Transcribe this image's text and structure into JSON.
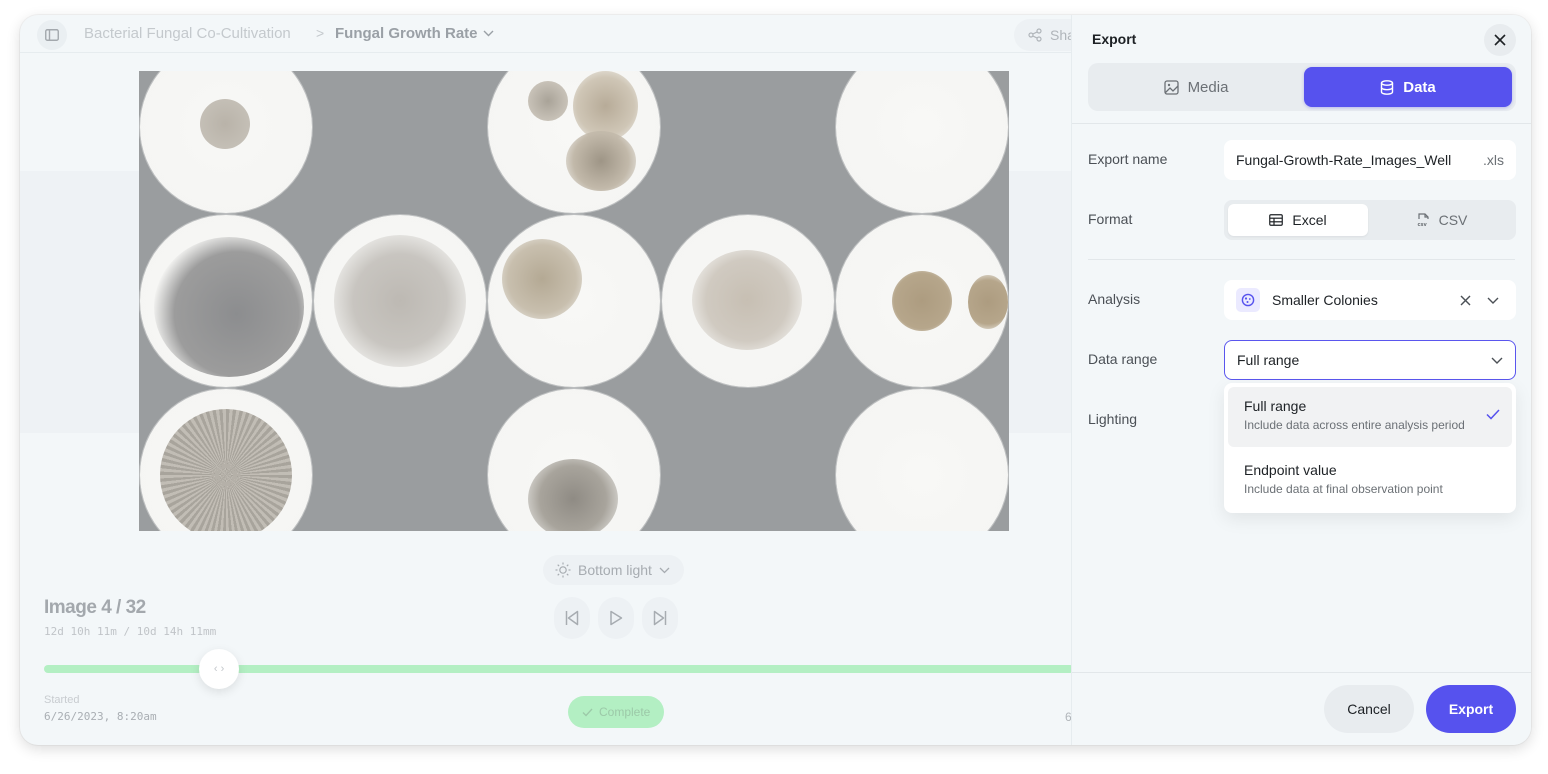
{
  "header": {
    "breadcrumb_root": "Bacterial Fungal Co-Cultivation",
    "breadcrumb_separator": ">",
    "breadcrumb_current": "Fungal Growth Rate",
    "share_label": "Sha"
  },
  "viewer": {
    "lighting_label": "Bottom light",
    "image_counter": "Image 4 / 32",
    "image_time": "12d 10h 11m / 10d 14h 11mm",
    "timeline_position_fraction": 0.17,
    "started_label": "Started",
    "started_value": "6/26/2023, 8:20am",
    "status_label": "Complete",
    "end_value_partial": "6",
    "status_color": "#b3efc3"
  },
  "export_panel": {
    "title": "Export",
    "tabs": [
      {
        "label": "Media",
        "icon": "image-icon",
        "active": false
      },
      {
        "label": "Data",
        "icon": "database-icon",
        "active": true
      }
    ],
    "export_name_label": "Export name",
    "export_name_value": "Fungal-Growth-Rate_Images_Well",
    "export_name_extension": ".xls",
    "format_label": "Format",
    "format_options": [
      {
        "label": "Excel",
        "icon": "table-icon",
        "selected": true
      },
      {
        "label": "CSV",
        "icon": "csv-file-icon",
        "selected": false
      }
    ],
    "analysis_label": "Analysis",
    "analysis_value": "Smaller Colonies",
    "data_range_label": "Data range",
    "data_range_value": "Full range",
    "lighting_label": "Lighting",
    "data_range_options": [
      {
        "title": "Full range",
        "description": "Include data across entire analysis period",
        "selected": true
      },
      {
        "title": "Endpoint value",
        "description": "Include data at final observation point",
        "selected": false
      }
    ],
    "cancel_label": "Cancel",
    "export_label": "Export",
    "accent_color": "#5652ee"
  }
}
